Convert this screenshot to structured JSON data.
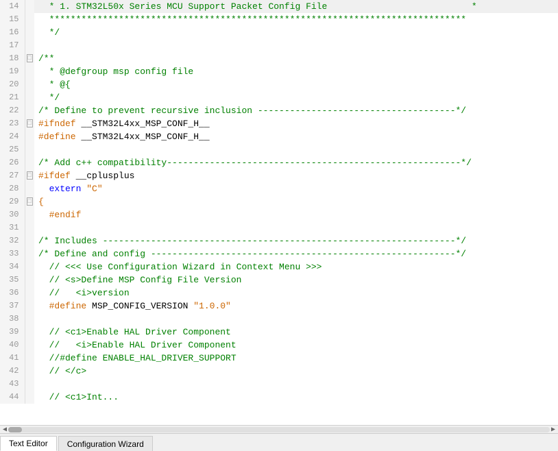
{
  "lines": [
    {
      "num": 14,
      "fold": "",
      "tokens": [
        {
          "cls": "c-comment",
          "text": "  * 1. STM32L50x Series MCU Support Packet Config File                           *"
        }
      ]
    },
    {
      "num": 15,
      "fold": "",
      "tokens": [
        {
          "cls": "c-comment",
          "text": "  ******************************************************************************"
        }
      ]
    },
    {
      "num": 16,
      "fold": "",
      "tokens": [
        {
          "cls": "c-comment",
          "text": "  */"
        }
      ]
    },
    {
      "num": 17,
      "fold": "",
      "tokens": []
    },
    {
      "num": 18,
      "fold": "□",
      "tokens": [
        {
          "cls": "c-comment",
          "text": "/**"
        }
      ]
    },
    {
      "num": 19,
      "fold": "",
      "tokens": [
        {
          "cls": "c-comment",
          "text": "  * @defgroup msp config file"
        }
      ]
    },
    {
      "num": 20,
      "fold": "",
      "tokens": [
        {
          "cls": "c-comment",
          "text": "  * @{"
        }
      ]
    },
    {
      "num": 21,
      "fold": "",
      "tokens": [
        {
          "cls": "c-comment",
          "text": "  */"
        }
      ]
    },
    {
      "num": 22,
      "fold": "",
      "tokens": [
        {
          "cls": "c-comment",
          "text": "/* Define to prevent recursive inclusion -------------------------------------*/"
        }
      ]
    },
    {
      "num": 23,
      "fold": "□",
      "tokens": [
        {
          "cls": "c-preproc",
          "text": "#ifndef"
        },
        {
          "cls": "c-normal",
          "text": " __STM32L4xx_MSP_CONF_H__"
        }
      ]
    },
    {
      "num": 24,
      "fold": "",
      "tokens": [
        {
          "cls": "c-preproc",
          "text": "#define"
        },
        {
          "cls": "c-normal",
          "text": " __STM32L4xx_MSP_CONF_H__"
        }
      ]
    },
    {
      "num": 25,
      "fold": "",
      "tokens": []
    },
    {
      "num": 26,
      "fold": "",
      "tokens": [
        {
          "cls": "c-comment",
          "text": "/* Add c++ compatibility-------------------------------------------------------*/"
        }
      ]
    },
    {
      "num": 27,
      "fold": "□",
      "tokens": [
        {
          "cls": "c-preproc",
          "text": "#ifdef"
        },
        {
          "cls": "c-normal",
          "text": " __cplusplus"
        }
      ]
    },
    {
      "num": 28,
      "fold": "",
      "tokens": [
        {
          "cls": "c-extern",
          "text": "  extern"
        },
        {
          "cls": "c-normal",
          "text": " "
        },
        {
          "cls": "c-string",
          "text": "\"C\""
        }
      ]
    },
    {
      "num": 29,
      "fold": "□",
      "tokens": [
        {
          "cls": "c-preproc",
          "text": "{"
        }
      ]
    },
    {
      "num": 30,
      "fold": "",
      "tokens": [
        {
          "cls": "c-preproc",
          "text": "  #endif"
        }
      ]
    },
    {
      "num": 31,
      "fold": "",
      "tokens": []
    },
    {
      "num": 32,
      "fold": "",
      "tokens": [
        {
          "cls": "c-comment",
          "text": "/* Includes ------------------------------------------------------------------*/"
        }
      ]
    },
    {
      "num": 33,
      "fold": "",
      "tokens": [
        {
          "cls": "c-comment",
          "text": "/* Define and config ---------------------------------------------------------*/"
        }
      ]
    },
    {
      "num": 34,
      "fold": "",
      "tokens": [
        {
          "cls": "c-comment",
          "text": "  // <<< Use Configuration Wizard in Context Menu >>>"
        }
      ]
    },
    {
      "num": 35,
      "fold": "",
      "tokens": [
        {
          "cls": "c-comment",
          "text": "  // <s>Define MSP Config File Version"
        }
      ]
    },
    {
      "num": 36,
      "fold": "",
      "tokens": [
        {
          "cls": "c-comment",
          "text": "  //   <i>version"
        }
      ]
    },
    {
      "num": 37,
      "fold": "",
      "tokens": [
        {
          "cls": "c-preproc",
          "text": "  #define"
        },
        {
          "cls": "c-normal",
          "text": " MSP_CONFIG_VERSION "
        },
        {
          "cls": "c-string",
          "text": "\"1.0.0\""
        }
      ]
    },
    {
      "num": 38,
      "fold": "",
      "tokens": []
    },
    {
      "num": 39,
      "fold": "",
      "tokens": [
        {
          "cls": "c-comment",
          "text": "  // <c1>Enable HAL Driver Component"
        }
      ]
    },
    {
      "num": 40,
      "fold": "",
      "tokens": [
        {
          "cls": "c-comment",
          "text": "  //   <i>Enable HAL Driver Component"
        }
      ]
    },
    {
      "num": 41,
      "fold": "",
      "tokens": [
        {
          "cls": "c-comment",
          "text": "  //#define ENABLE_HAL_DRIVER_SUPPORT"
        }
      ]
    },
    {
      "num": 42,
      "fold": "",
      "tokens": [
        {
          "cls": "c-comment",
          "text": "  // </c>"
        }
      ]
    },
    {
      "num": 43,
      "fold": "",
      "tokens": []
    },
    {
      "num": 44,
      "fold": "",
      "tokens": [
        {
          "cls": "c-comment",
          "text": "  // <c1>Int..."
        }
      ]
    }
  ],
  "tabs": [
    {
      "label": "Text Editor",
      "active": true
    },
    {
      "label": "Configuration Wizard",
      "active": false
    }
  ],
  "scrollbar": {
    "left_arrow": "◀",
    "right_arrow": "▶"
  }
}
